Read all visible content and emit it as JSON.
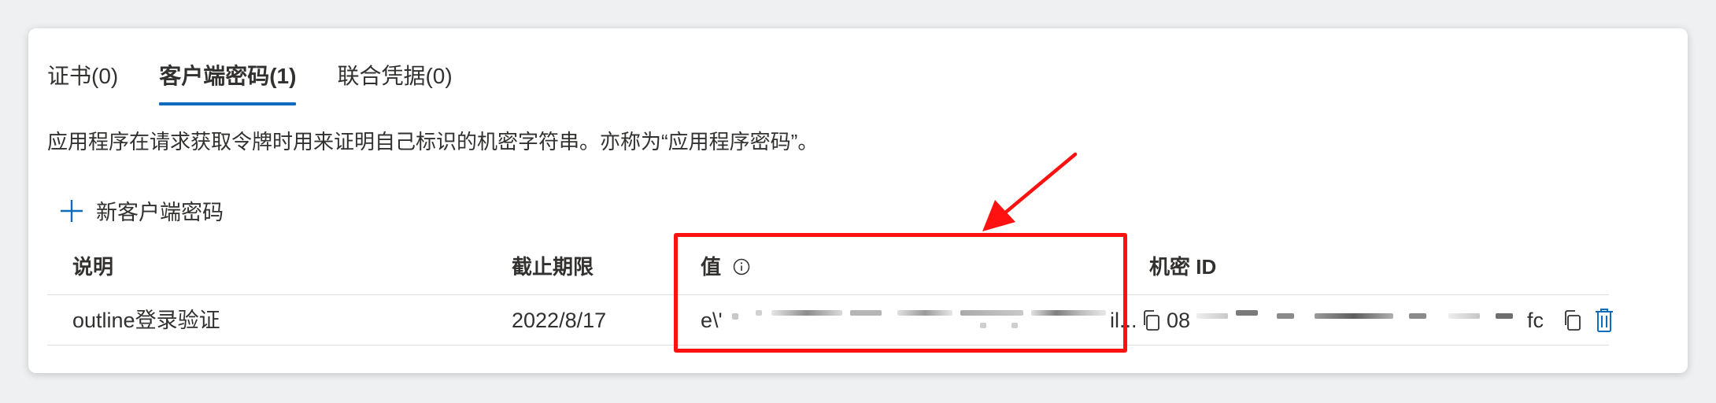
{
  "tabs": [
    {
      "label": "证书(0)",
      "active": false
    },
    {
      "label": "客户端密码(1)",
      "active": true
    },
    {
      "label": "联合凭据(0)",
      "active": false
    }
  ],
  "description": "应用程序在请求获取令牌时用来证明自己标识的机密字符串。亦称为“应用程序密码”。",
  "new_secret_label": "新客户端密码",
  "table": {
    "headers": {
      "description": "说明",
      "expires": "截止期限",
      "value": "值",
      "secret_id": "机密 ID"
    },
    "rows": [
      {
        "description": "outline登录验证",
        "expires": "2022/8/17",
        "value_prefix": "e\\'",
        "value_suffix": "il...",
        "secret_id_prefix": "08",
        "secret_id_suffix": "fc"
      }
    ]
  },
  "colors": {
    "accent": "#0f6cbd",
    "highlight": "#ff1111",
    "text": "#323130"
  }
}
